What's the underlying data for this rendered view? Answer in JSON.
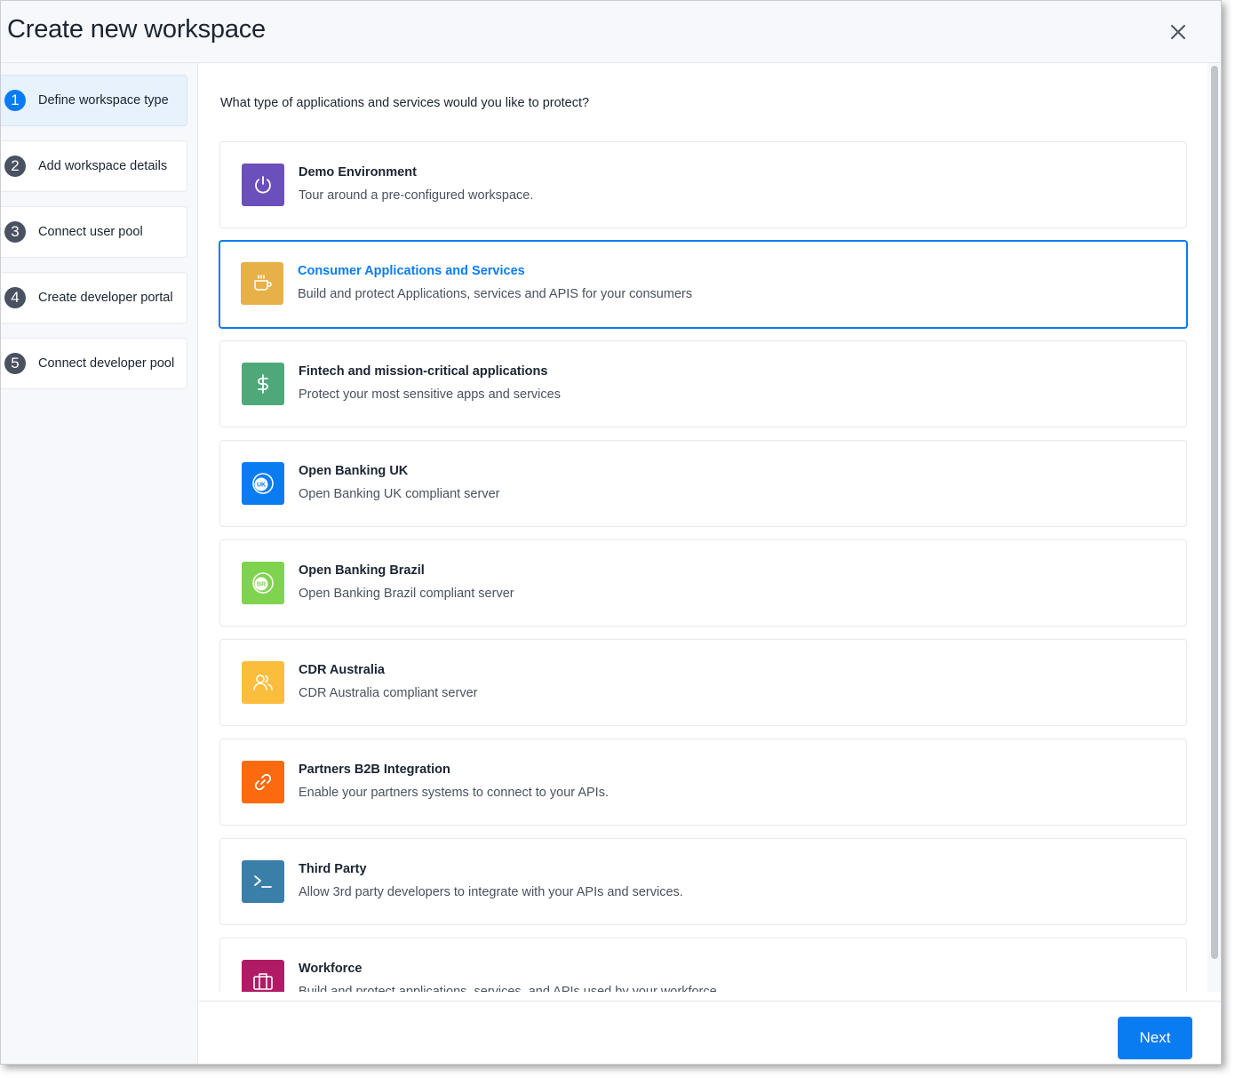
{
  "dialog": {
    "title": "Create new workspace",
    "close_icon": "close-icon"
  },
  "steps": [
    {
      "number": "1",
      "label": "Define workspace type",
      "active": true
    },
    {
      "number": "2",
      "label": "Add workspace details",
      "active": false
    },
    {
      "number": "3",
      "label": "Connect user pool",
      "active": false
    },
    {
      "number": "4",
      "label": "Create developer portal",
      "active": false
    },
    {
      "number": "5",
      "label": "Connect developer pool",
      "active": false
    }
  ],
  "main": {
    "question": "What type of applications and services would you like to protect?",
    "options": [
      {
        "title": "Demo Environment",
        "description": "Tour around a pre-configured workspace.",
        "icon": "power-icon",
        "color": "#6b4fbb",
        "selected": false
      },
      {
        "title": "Consumer Applications and Services",
        "description": "Build and protect Applications, services and APIS for your consumers",
        "icon": "coffee-cup-icon",
        "color": "#e8b048",
        "selected": true
      },
      {
        "title": "Fintech and mission-critical applications",
        "description": "Protect your most sensitive apps and services",
        "icon": "dollar-icon",
        "color": "#4fa87a",
        "selected": false
      },
      {
        "title": "Open Banking UK",
        "description": "Open Banking UK compliant server",
        "icon": "uk-badge-icon",
        "badge": "UK",
        "color": "#0a7cf2",
        "selected": false
      },
      {
        "title": "Open Banking Brazil",
        "description": "Open Banking Brazil compliant server",
        "icon": "br-badge-icon",
        "badge": "BR",
        "color": "#7fd34e",
        "selected": false
      },
      {
        "title": "CDR Australia",
        "description": "CDR Australia compliant server",
        "icon": "users-icon",
        "color": "#fbbd3c",
        "selected": false
      },
      {
        "title": "Partners B2B Integration",
        "description": "Enable your partners systems to connect to your APIs.",
        "icon": "link-icon",
        "color": "#fb6a0e",
        "selected": false
      },
      {
        "title": "Third Party",
        "description": "Allow 3rd party developers to integrate with your APIs and services.",
        "icon": "terminal-icon",
        "color": "#3a7fa8",
        "selected": false
      },
      {
        "title": "Workforce",
        "description": "Build and protect applications, services, and APIs used by your workforce",
        "icon": "briefcase-icon",
        "color": "#b11b66",
        "selected": false
      }
    ]
  },
  "footer": {
    "next_label": "Next"
  }
}
